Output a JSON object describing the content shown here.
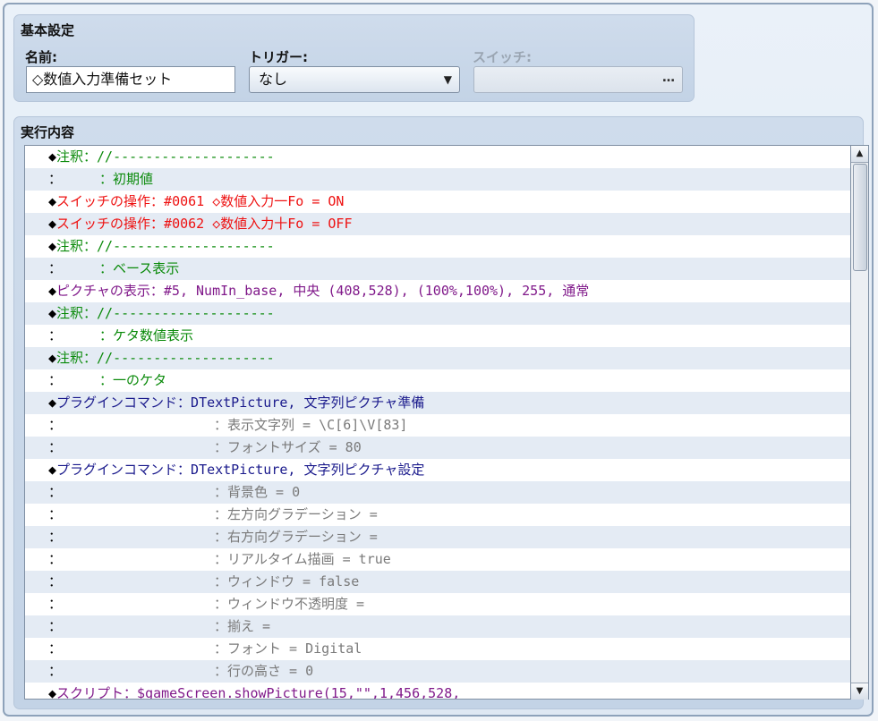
{
  "basic": {
    "group_title": "基本設定",
    "name_label": "名前:",
    "name_value": "◇数値入力準備セット",
    "trigger_label": "トリガー:",
    "trigger_value": "なし",
    "switch_label": "スイッチ:",
    "switch_button": "…"
  },
  "contents": {
    "group_title": "実行内容",
    "rows": [
      {
        "lead": "◆",
        "text": "注釈：//--------------------",
        "color": "green"
      },
      {
        "lead": "：",
        "pad": "cmt",
        "text": "：初期値",
        "color": "green"
      },
      {
        "lead": "◆",
        "text": "スイッチの操作：#0061 ◇数値入力一Fo = ON",
        "color": "red"
      },
      {
        "lead": "◆",
        "text": "スイッチの操作：#0062 ◇数値入力十Fo = OFF",
        "color": "red"
      },
      {
        "lead": "◆",
        "text": "注釈：//--------------------",
        "color": "green"
      },
      {
        "lead": "：",
        "pad": "cmt",
        "text": "：ベース表示",
        "color": "green"
      },
      {
        "lead": "◆",
        "text": "ピクチャの表示：#5, NumIn_base, 中央 (408,528), (100%,100%), 255, 通常",
        "color": "purple"
      },
      {
        "lead": "◆",
        "text": "注釈：//--------------------",
        "color": "green"
      },
      {
        "lead": "：",
        "pad": "cmt",
        "text": "：ケタ数値表示",
        "color": "green"
      },
      {
        "lead": "◆",
        "text": "注釈：//--------------------",
        "color": "green"
      },
      {
        "lead": "：",
        "pad": "cmt",
        "text": "：一のケタ",
        "color": "green"
      },
      {
        "lead": "◆",
        "text": "プラグインコマンド：DTextPicture, 文字列ピクチャ準備",
        "color": "navy"
      },
      {
        "lead": "：",
        "pad": "pc",
        "text": "：表示文字列 = \\C[6]\\V[83]",
        "color": "gray"
      },
      {
        "lead": "：",
        "pad": "pc",
        "text": "：フォントサイズ = 80",
        "color": "gray"
      },
      {
        "lead": "◆",
        "text": "プラグインコマンド：DTextPicture, 文字列ピクチャ設定",
        "color": "navy"
      },
      {
        "lead": "：",
        "pad": "pc",
        "text": "：背景色 = 0",
        "color": "gray"
      },
      {
        "lead": "：",
        "pad": "pc",
        "text": "：左方向グラデーション =",
        "color": "gray"
      },
      {
        "lead": "：",
        "pad": "pc",
        "text": "：右方向グラデーション =",
        "color": "gray"
      },
      {
        "lead": "：",
        "pad": "pc",
        "text": "：リアルタイム描画 = true",
        "color": "gray"
      },
      {
        "lead": "：",
        "pad": "pc",
        "text": "：ウィンドウ = false",
        "color": "gray"
      },
      {
        "lead": "：",
        "pad": "pc",
        "text": "：ウィンドウ不透明度 =",
        "color": "gray"
      },
      {
        "lead": "：",
        "pad": "pc",
        "text": "：揃え =",
        "color": "gray"
      },
      {
        "lead": "：",
        "pad": "pc",
        "text": "：フォント = Digital",
        "color": "gray"
      },
      {
        "lead": "：",
        "pad": "pc",
        "text": "：行の高さ = 0",
        "color": "gray"
      },
      {
        "lead": "◆",
        "text": "スクリプト：$gameScreen.showPicture(15,\"\",1,456,528,",
        "color": "purple"
      }
    ]
  },
  "scrollbar": {
    "up_icon": "▲",
    "down_icon": "▼"
  }
}
